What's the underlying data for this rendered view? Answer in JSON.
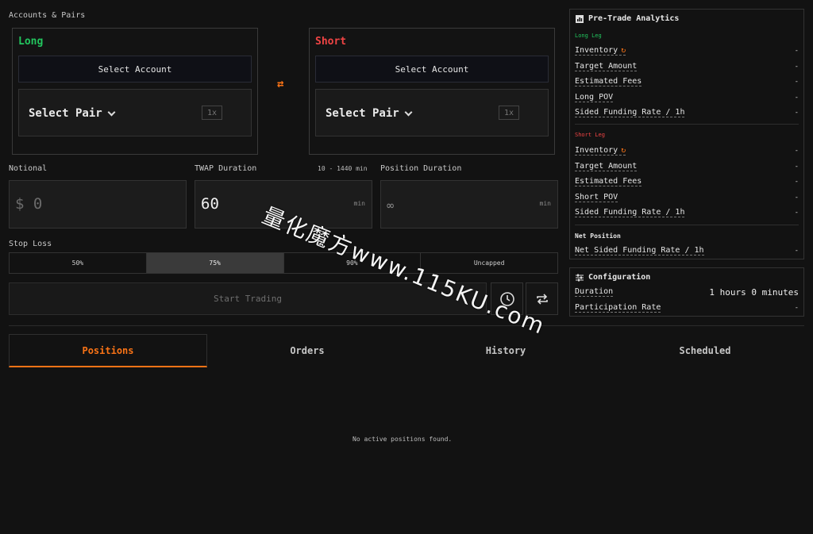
{
  "accounts": {
    "section_label": "Accounts & Pairs",
    "long": {
      "title": "Long",
      "select_account": "Select Account",
      "select_pair": "Select Pair",
      "leverage": "1x"
    },
    "short": {
      "title": "Short",
      "select_account": "Select Account",
      "select_pair": "Select Pair",
      "leverage": "1x"
    },
    "swap_icon": "swap-arrows-icon"
  },
  "inputs": {
    "notional": {
      "label": "Notional",
      "value": "$ 0"
    },
    "twap": {
      "label": "TWAP Duration",
      "hint": "10 - 1440 min",
      "value": "60",
      "unit": "min"
    },
    "position": {
      "label": "Position Duration",
      "value": "∞",
      "unit": "min"
    }
  },
  "stop_loss": {
    "label": "Stop Loss",
    "options": [
      "50%",
      "75%",
      "90%",
      "Uncapped"
    ],
    "selected": "75%"
  },
  "start_button": "Start Trading",
  "tabs": [
    "Positions",
    "Orders",
    "History",
    "Scheduled"
  ],
  "active_tab": "Positions",
  "empty_message": "No active positions found.",
  "analytics": {
    "title": "Pre-Trade Analytics",
    "long_leg": {
      "label": "Long Leg",
      "rows": [
        {
          "key": "Inventory",
          "value": "-"
        },
        {
          "key": "Target Amount",
          "value": "-"
        },
        {
          "key": "Estimated Fees",
          "value": "-"
        },
        {
          "key": "Long POV",
          "value": "-"
        },
        {
          "key": "Sided Funding Rate / 1h",
          "value": "-"
        }
      ]
    },
    "short_leg": {
      "label": "Short Leg",
      "rows": [
        {
          "key": "Inventory",
          "value": "-"
        },
        {
          "key": "Target Amount",
          "value": "-"
        },
        {
          "key": "Estimated Fees",
          "value": "-"
        },
        {
          "key": "Short POV",
          "value": "-"
        },
        {
          "key": "Sided Funding Rate / 1h",
          "value": "-"
        }
      ]
    },
    "net": {
      "label": "Net Position",
      "row": {
        "key": "Net Sided Funding Rate / 1h",
        "value": "-"
      }
    }
  },
  "configuration": {
    "title": "Configuration",
    "rows": [
      {
        "key": "Duration",
        "value": "1 hours 0 minutes"
      },
      {
        "key": "Participation Rate",
        "value": "-"
      }
    ]
  },
  "watermark": "量化魔方www.115KU.com",
  "colors": {
    "accent": "#f97316",
    "long": "#22c55e",
    "short": "#ef4444"
  }
}
